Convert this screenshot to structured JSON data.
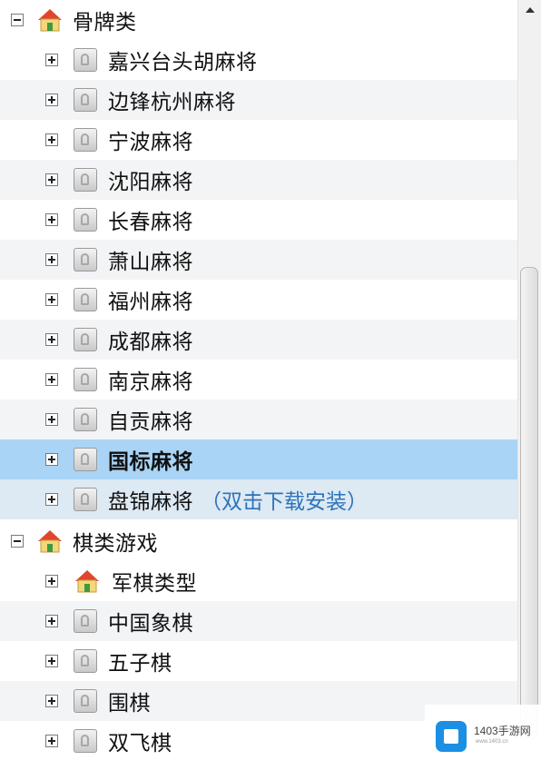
{
  "tree": {
    "group_mahjong": {
      "label": "骨牌类",
      "children": [
        {
          "label": "嘉兴台头胡麻将"
        },
        {
          "label": "边锋杭州麻将"
        },
        {
          "label": "宁波麻将"
        },
        {
          "label": "沈阳麻将"
        },
        {
          "label": "长春麻将"
        },
        {
          "label": "萧山麻将"
        },
        {
          "label": "福州麻将"
        },
        {
          "label": "成都麻将"
        },
        {
          "label": "南京麻将"
        },
        {
          "label": "自贡麻将"
        },
        {
          "label": "国标麻将"
        },
        {
          "label": "盘锦麻将",
          "note": "（双击下载安装）"
        }
      ]
    },
    "group_chess": {
      "label": "棋类游戏",
      "children": [
        {
          "label": "军棋类型"
        },
        {
          "label": "中国象棋"
        },
        {
          "label": "五子棋"
        },
        {
          "label": "围棋"
        },
        {
          "label": "双飞棋"
        }
      ]
    }
  },
  "colors": {
    "selected_row": "#a9d4f5",
    "hover_row": "#dde9f3",
    "note_text": "#2d73ba",
    "house_roof": "#e0452e",
    "house_body": "#f3d77a"
  },
  "icons": {
    "group": "house-icon",
    "game": "game-placeholder-icon",
    "expand": "plus-box-icon",
    "collapse": "minus-box-icon"
  },
  "watermark": {
    "title": "1403手游网",
    "url": "www.1403.cn"
  }
}
